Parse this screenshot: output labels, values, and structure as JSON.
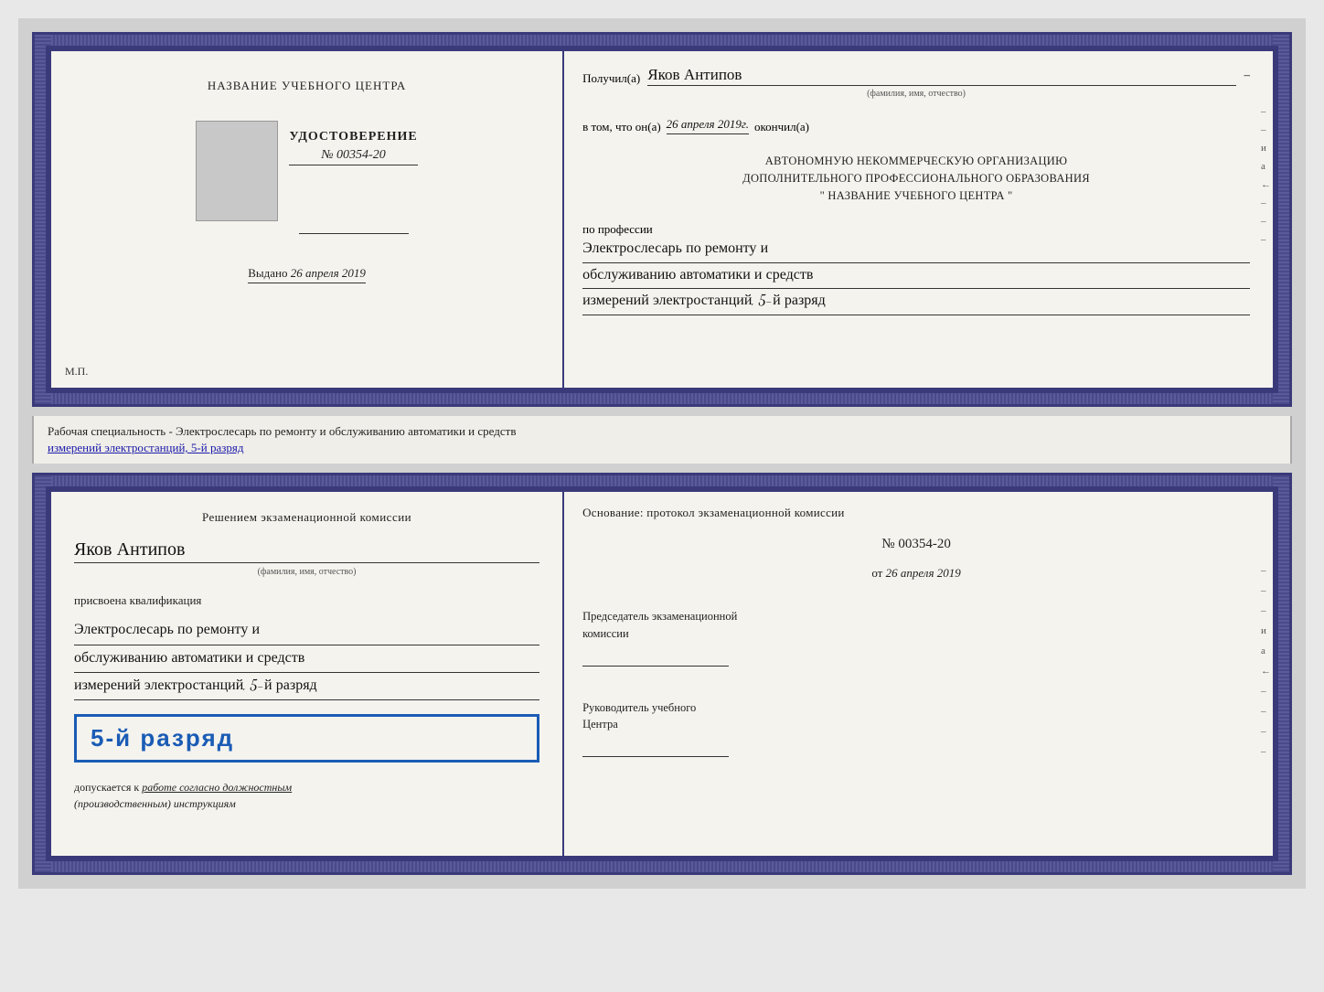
{
  "cert_top": {
    "left": {
      "title": "НАЗВАНИЕ УЧЕБНОГО ЦЕНТРА",
      "photo_alt": "photo",
      "udostoverenie_label": "УДОСТОВЕРЕНИЕ",
      "number": "№ 00354-20",
      "vydano_label": "Выдано",
      "vydano_date": "26 апреля 2019",
      "mp": "М.П."
    },
    "right": {
      "poluchil_label": "Получил(а)",
      "poluchil_value": "Яков Антипов",
      "fio_subtitle": "(фамилия, имя, отчество)",
      "vtom_label": "в том, что он(а)",
      "vtom_date": "26 апреля 2019г.",
      "okonchil_label": "окончил(а)",
      "org_line1": "АВТОНОМНУЮ НЕКОММЕРЧЕСКУЮ ОРГАНИЗАЦИЮ",
      "org_line2": "ДОПОЛНИТЕЛЬНОГО ПРОФЕССИОНАЛЬНОГО ОБРАЗОВАНИЯ",
      "org_name": "\"  НАЗВАНИЕ УЧЕБНОГО ЦЕНТРА  \"",
      "po_professii": "по профессии",
      "profession_line1": "Электрослесарь по ремонту и",
      "profession_line2": "обслуживанию автоматики и средств",
      "profession_line3": "измерений электростанций, 5-й разряд"
    }
  },
  "middle_text": {
    "main": "Рабочая специальность - Электрослесарь по ремонту и обслуживанию автоматики и средств",
    "underline": "измерений электростанций, 5-й разряд"
  },
  "cert_bottom": {
    "left": {
      "resolution_title": "Решением экзаменационной комиссии",
      "name_value": "Яков Антипов",
      "fio_subtitle": "(фамилия, имя, отчество)",
      "prisvoena": "присвоена квалификация",
      "qual_line1": "Электрослесарь по ремонту и",
      "qual_line2": "обслуживанию автоматики и средств",
      "qual_line3": "измерений электростанций, 5-й разряд",
      "razryad_badge": "5-й разряд",
      "dopuskaetsya_label": "допускается к",
      "dopuskaetsya_value": "работе согласно должностным",
      "dopuskaetsya_value2": "(производственным) инструкциям"
    },
    "right": {
      "osnovaniye": "Основание: протокол экзаменационной комиссии",
      "number": "№  00354-20",
      "ot_label": "от",
      "ot_date": "26 апреля 2019",
      "predsedatel_line1": "Председатель экзаменационной",
      "predsedatel_line2": "комиссии",
      "rukovoditel_line1": "Руководитель учебного",
      "rukovoditel_line2": "Центра"
    }
  }
}
